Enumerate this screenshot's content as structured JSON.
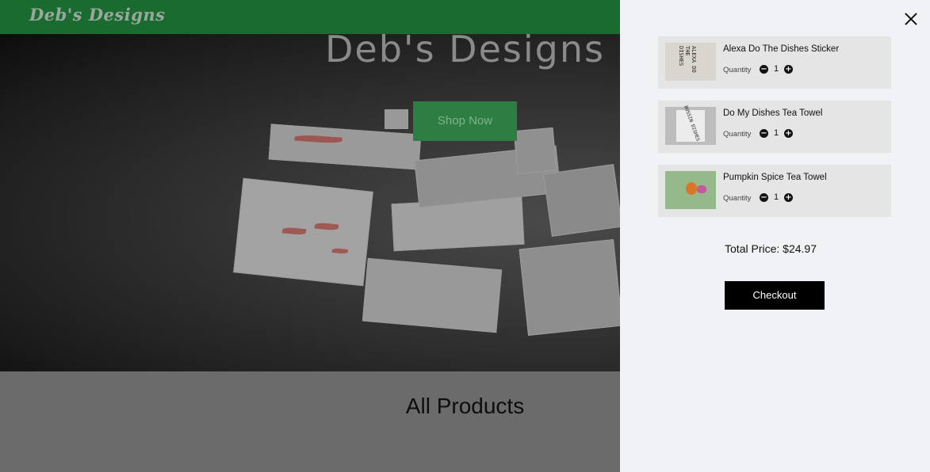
{
  "navbar": {
    "brand": "Deb's Designs"
  },
  "hero": {
    "title": "Deb's Designs",
    "cta_label": "Shop Now"
  },
  "products": {
    "heading": "All Products"
  },
  "cart": {
    "items": [
      {
        "name": "Alexa Do The Dishes Sticker",
        "quantity_label": "Quantity",
        "quantity": "1",
        "thumb_text": "ALEXA DO THE DISHES"
      },
      {
        "name": "Do My Dishes Tea Towel",
        "quantity_label": "Quantity",
        "quantity": "1",
        "thumb_text": "BUSSIN DISHES"
      },
      {
        "name": "Pumpkin Spice Tea Towel",
        "quantity_label": "Quantity",
        "quantity": "1",
        "thumb_text": ""
      }
    ],
    "total": "Total Price: $24.97",
    "checkout_label": "Checkout"
  },
  "colors": {
    "brand_green": "#1a6b30",
    "cta_green": "#2e7d43",
    "drawer_bg": "#f1f2f5",
    "item_bg": "#e5e5e5",
    "checkout_bg": "#000000"
  },
  "icons": {
    "close": "close-icon",
    "minus": "minus-circle-icon",
    "plus": "plus-circle-icon"
  }
}
